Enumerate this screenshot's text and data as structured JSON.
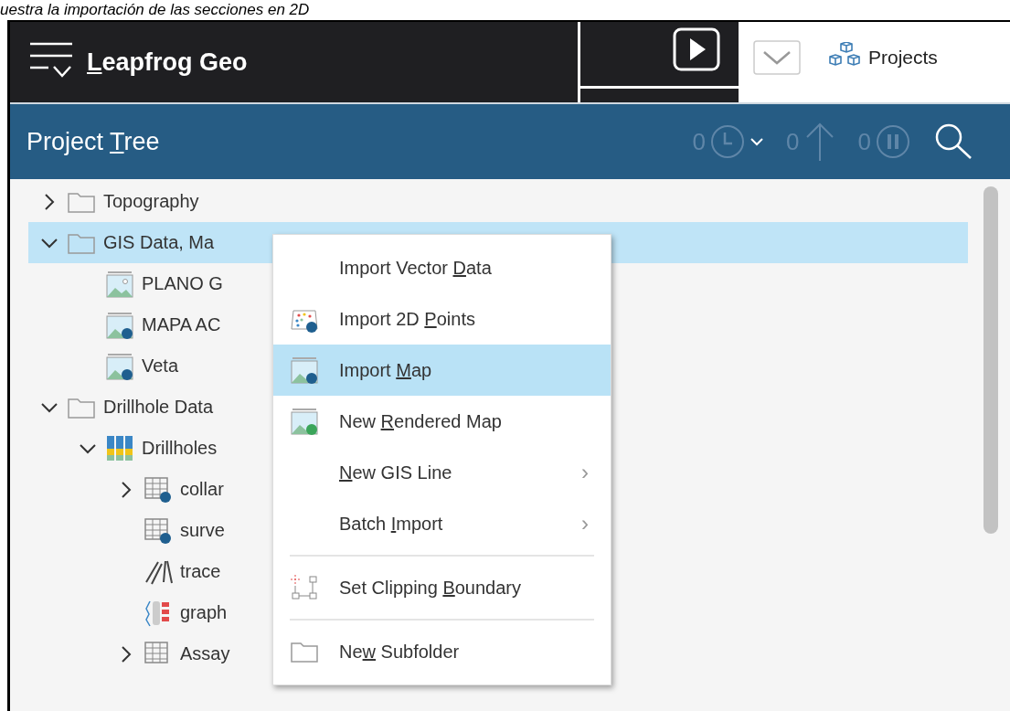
{
  "caption": "uestra la importación de las secciones en 2D",
  "app": {
    "title": {
      "key": "L",
      "post": "eapfrog Geo"
    },
    "projects_tab": "Projects"
  },
  "panel": {
    "title": {
      "pre": "Project ",
      "key": "T",
      "post": "ree"
    },
    "counters": [
      "0",
      "0",
      "0"
    ]
  },
  "tree": [
    {
      "label": "Topography",
      "kind": "folder",
      "expanded": false,
      "selected": false
    },
    {
      "label": "GIS Data, Ma",
      "kind": "folder",
      "expanded": true,
      "selected": true,
      "children": [
        {
          "label": "PLANO G",
          "kind": "map",
          "selected": false
        },
        {
          "label": "MAPA AC",
          "kind": "map-import",
          "selected": false
        },
        {
          "label": "Veta",
          "kind": "map-import",
          "selected": false
        }
      ]
    },
    {
      "label": "Drillhole Data",
      "kind": "folder",
      "expanded": true,
      "selected": false,
      "children": [
        {
          "label": "Drillholes",
          "kind": "drillholes",
          "expanded": true,
          "selected": false,
          "children": [
            {
              "label": "collar",
              "kind": "table",
              "expanded": false,
              "selected": false
            },
            {
              "label": "surve",
              "kind": "table",
              "selected": false
            },
            {
              "label": "trace",
              "kind": "traces",
              "selected": false
            },
            {
              "label": "graph",
              "kind": "graph",
              "selected": false
            },
            {
              "label": "Assay",
              "kind": "table-plain",
              "expanded": false,
              "selected": false
            }
          ]
        }
      ]
    }
  ],
  "menu": [
    {
      "kind": "plain",
      "label": {
        "pre": "Import Vector ",
        "key": "D",
        "post": "ata"
      },
      "selected": false
    },
    {
      "kind": "points",
      "label": {
        "pre": "Import 2D ",
        "key": "P",
        "post": "oints"
      },
      "selected": false
    },
    {
      "kind": "map-import",
      "label": {
        "pre": "Import ",
        "key": "M",
        "post": "ap"
      },
      "selected": true
    },
    {
      "kind": "map-new",
      "label": {
        "pre": "New ",
        "key": "R",
        "post": "endered Map"
      },
      "selected": false
    },
    {
      "kind": "submenu",
      "label": {
        "key": "N",
        "post": "ew GIS Line"
      },
      "arrow": "›",
      "selected": false
    },
    {
      "kind": "submenu",
      "label": {
        "pre": "Batch ",
        "key": "I",
        "post": "mport"
      },
      "arrow": "›",
      "selected": false
    },
    {
      "kind": "separator"
    },
    {
      "kind": "clipping",
      "label": {
        "pre": "Set Clipping ",
        "key": "B",
        "post": "oundary"
      },
      "selected": false
    },
    {
      "kind": "separator"
    },
    {
      "kind": "folder",
      "label": {
        "pre": "Ne",
        "key": "w",
        "post": " Subfolder"
      },
      "selected": false
    }
  ]
}
